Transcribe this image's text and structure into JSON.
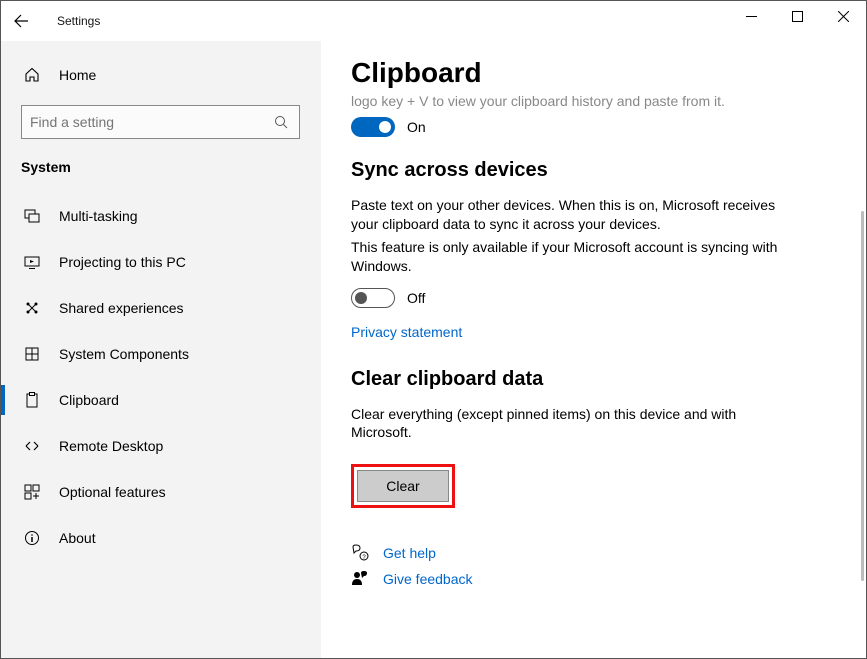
{
  "window": {
    "title": "Settings"
  },
  "sidebar": {
    "home_label": "Home",
    "search_placeholder": "Find a setting",
    "category": "System",
    "items": [
      {
        "label": "Multi-tasking"
      },
      {
        "label": "Projecting to this PC"
      },
      {
        "label": "Shared experiences"
      },
      {
        "label": "System Components"
      },
      {
        "label": "Clipboard"
      },
      {
        "label": "Remote Desktop"
      },
      {
        "label": "Optional features"
      },
      {
        "label": "About"
      }
    ]
  },
  "main": {
    "title": "Clipboard",
    "truncated_line": "logo key + V to view your clipboard history and paste from it.",
    "history": {
      "state": "On"
    },
    "sync": {
      "heading": "Sync across devices",
      "body1": "Paste text on your other devices. When this is on, Microsoft receives your clipboard data to sync it across your devices.",
      "body2": "This feature is only available if your Microsoft account is syncing with Windows.",
      "state": "Off",
      "privacy_link": "Privacy statement"
    },
    "clear": {
      "heading": "Clear clipboard data",
      "body": "Clear everything (except pinned items) on this device and with Microsoft.",
      "button": "Clear"
    },
    "help": {
      "get_help": "Get help",
      "feedback": "Give feedback"
    }
  }
}
